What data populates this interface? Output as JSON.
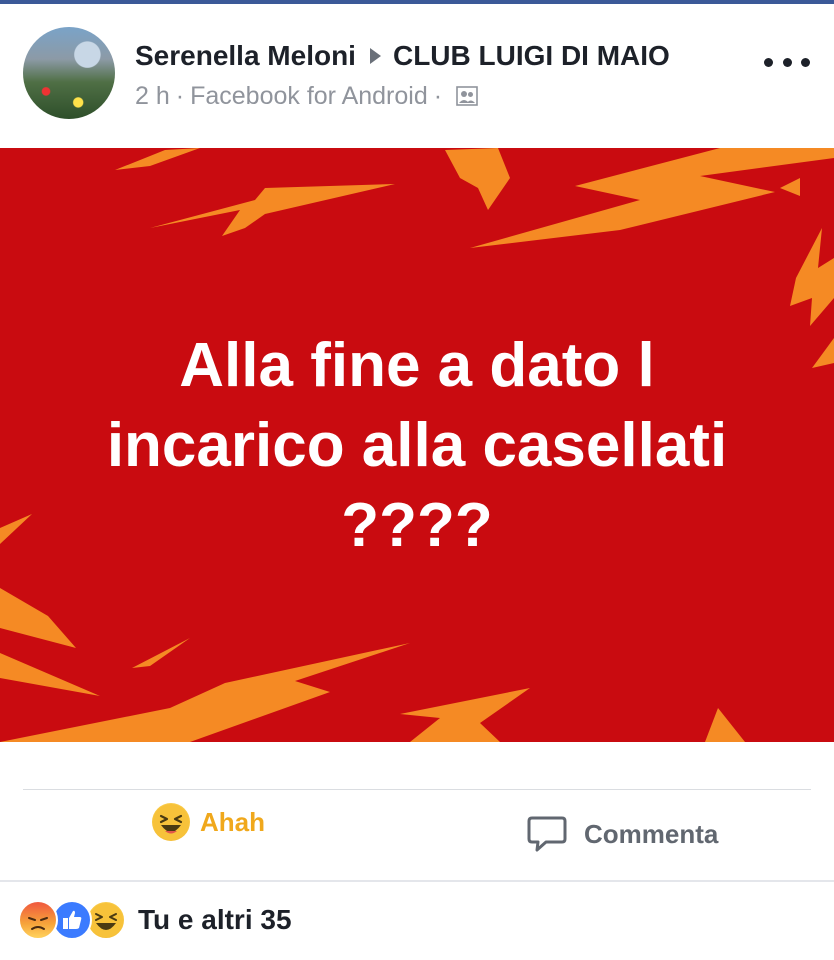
{
  "post": {
    "author": "Serenella Meloni",
    "group": "CLUB LUIGI DI MAIO",
    "time": "2 h",
    "separator": "·",
    "source": "Facebook for Android",
    "separator2": "·",
    "privacy_icon": "group-icon",
    "more_icon": "more-dots-icon",
    "image_text_lines": [
      "Alla fine a dato l",
      "incarico alla casellati",
      "????"
    ],
    "colors": {
      "background": "#c90b10",
      "bolt": "#f58a24",
      "text": "#ffffff"
    }
  },
  "actions": {
    "reaction_label": "Ahah",
    "reaction_icon": "haha-emoji-icon",
    "comment_label": "Commenta",
    "comment_icon": "comment-icon"
  },
  "reactions": {
    "icons": [
      "angry-reaction-icon",
      "like-reaction-icon",
      "haha-reaction-icon"
    ],
    "summary": "Tu e altri 35"
  }
}
